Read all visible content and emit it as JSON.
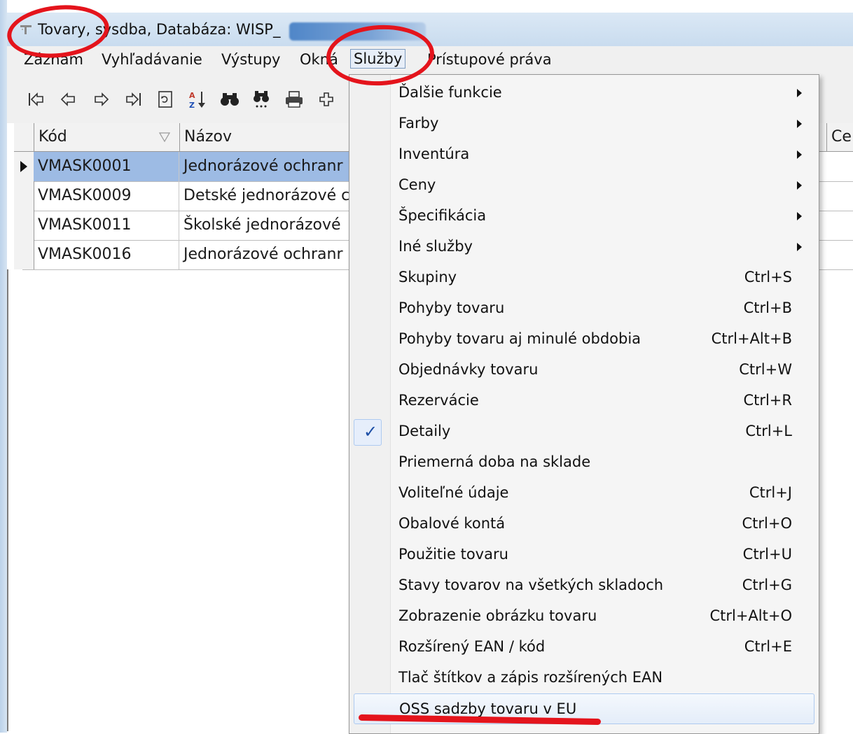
{
  "window": {
    "title": "Tovary, sysdba,  Databáza: WISP_"
  },
  "menubar": {
    "items": [
      "Záznam",
      "Vyhľadávanie",
      "Výstupy",
      "Okná",
      "Služby",
      "Prístupové práva"
    ],
    "active": "Služby"
  },
  "toolbar": {
    "icons": [
      "first-record-icon",
      "prev-record-icon",
      "next-record-icon",
      "last-record-icon",
      "refresh-icon",
      "sort-az-icon",
      "find-icon",
      "find-next-icon",
      "print-icon",
      "add-icon"
    ]
  },
  "grid": {
    "columns": [
      "Kód",
      "Názov",
      "Ce"
    ],
    "rows": [
      {
        "kod": "VMASK0001",
        "nazov": "Jednorázové ochranr",
        "selected": true
      },
      {
        "kod": "VMASK0009",
        "nazov": "Detské jednorázové c",
        "selected": false
      },
      {
        "kod": "VMASK0011",
        "nazov": "Školské jednorázové",
        "selected": false
      },
      {
        "kod": "VMASK0016",
        "nazov": "Jednorázové ochranr",
        "selected": false
      }
    ]
  },
  "dropdown": {
    "items": [
      {
        "label": "Ďalšie funkcie",
        "shortcut": "",
        "submenu": true
      },
      {
        "label": "Farby",
        "shortcut": "",
        "submenu": true
      },
      {
        "label": "Inventúra",
        "shortcut": "",
        "submenu": true
      },
      {
        "label": "Ceny",
        "shortcut": "",
        "submenu": true
      },
      {
        "label": "Špecifikácia",
        "shortcut": "",
        "submenu": true
      },
      {
        "label": "Iné služby",
        "shortcut": "",
        "submenu": true
      },
      {
        "label": "Skupiny",
        "shortcut": "Ctrl+S"
      },
      {
        "label": "Pohyby tovaru",
        "shortcut": "Ctrl+B"
      },
      {
        "label": "Pohyby tovaru aj minulé obdobia",
        "shortcut": "Ctrl+Alt+B"
      },
      {
        "label": "Objednávky tovaru",
        "shortcut": "Ctrl+W"
      },
      {
        "label": "Rezervácie",
        "shortcut": "Ctrl+R"
      },
      {
        "label": "Detaily",
        "shortcut": "Ctrl+L",
        "checked": true
      },
      {
        "label": "Priemerná doba na sklade",
        "shortcut": ""
      },
      {
        "label": "Voliteľné údaje",
        "shortcut": "Ctrl+J"
      },
      {
        "label": "Obalové kontá",
        "shortcut": "Ctrl+O"
      },
      {
        "label": "Použitie tovaru",
        "shortcut": "Ctrl+U"
      },
      {
        "label": "Stavy tovarov na všetkých skladoch",
        "shortcut": "Ctrl+G"
      },
      {
        "label": "Zobrazenie obrázku tovaru",
        "shortcut": "Ctrl+Alt+O"
      },
      {
        "label": "Rozšírený EAN / kód",
        "shortcut": "Ctrl+E"
      },
      {
        "label": "Tlač štítkov a zápis rozšírených EAN",
        "shortcut": ""
      },
      {
        "label": "OSS sadzby tovaru v EU",
        "shortcut": "",
        "highlighted": true
      }
    ]
  },
  "colors": {
    "annotation": "#e4141c",
    "selection": "#9dbbe4",
    "titlebar": "#c9dcef"
  }
}
